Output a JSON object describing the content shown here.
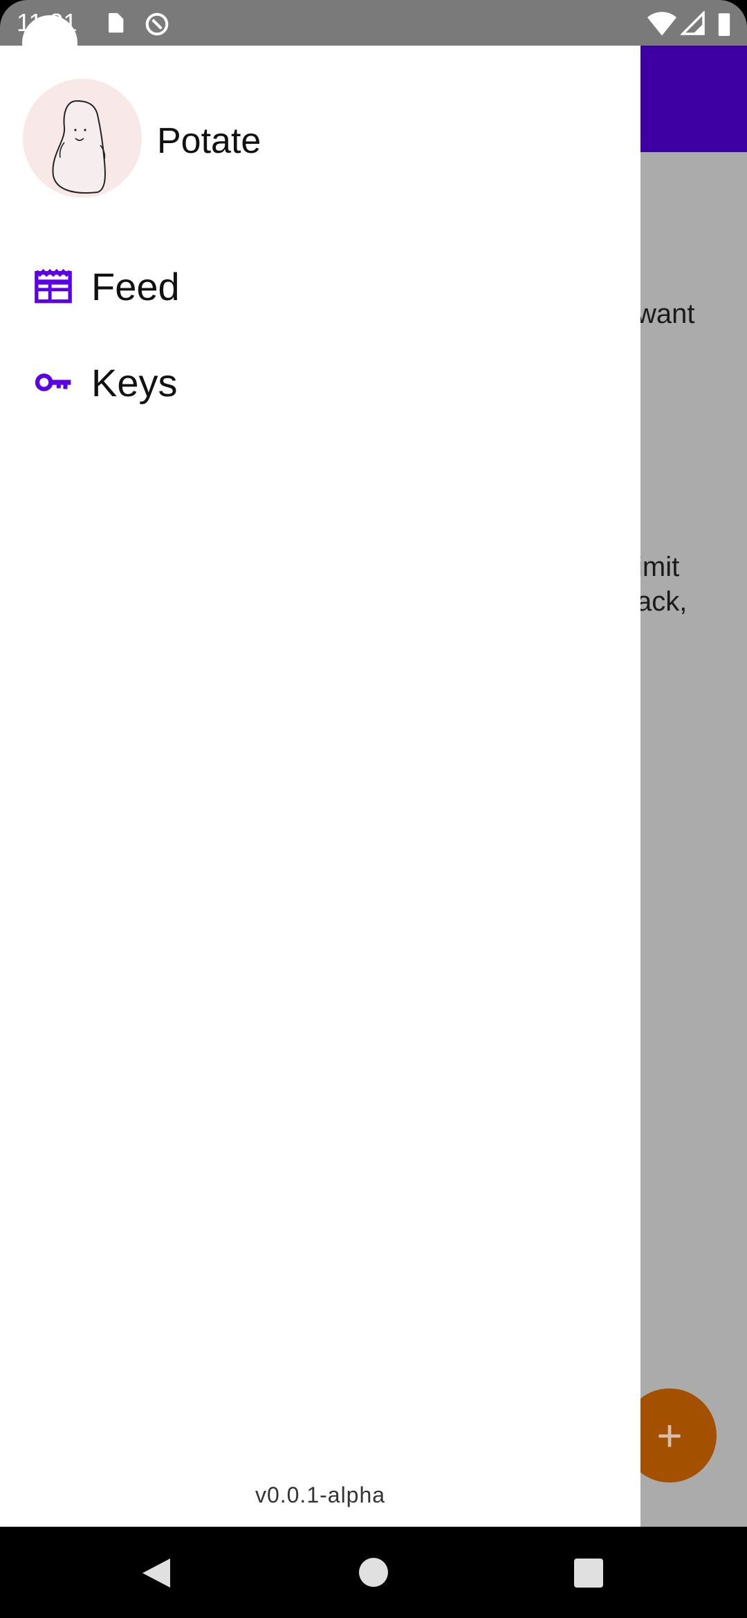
{
  "status_bar": {
    "time": "11:31"
  },
  "background": {
    "text_line1": "want",
    "text_line2": "imit",
    "text_line3": "ack,",
    "fab_label": "+"
  },
  "drawer": {
    "user_name": "Potate",
    "items": [
      {
        "label": "Feed",
        "icon": "feed-icon"
      },
      {
        "label": "Keys",
        "icon": "key-icon"
      }
    ],
    "version": "v0.0.1-alpha"
  },
  "colors": {
    "accent": "#5b00e6",
    "app_bar": "#3f00a3",
    "fab": "#a35100"
  }
}
